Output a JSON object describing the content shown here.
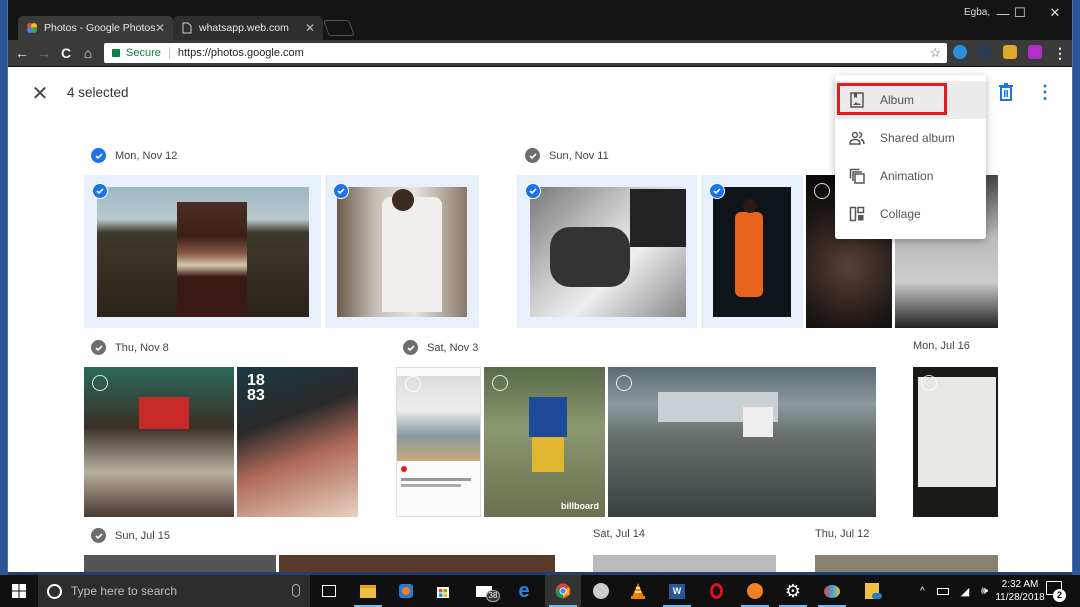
{
  "browser": {
    "tabs": [
      {
        "title": "Photos - Google Photos",
        "icon": "google-photos-icon",
        "active": true
      },
      {
        "title": "whatsapp.web.com",
        "icon": "page-icon",
        "active": false
      }
    ],
    "profile_name": "Egba,",
    "window_controls": {
      "minimize": "—",
      "maximize": "☐",
      "close": "✕"
    },
    "security_label": "Secure",
    "url": "https://photos.google.com",
    "nav_icons": {
      "back": "←",
      "forward": "→",
      "reload": "C",
      "home": "⌂"
    },
    "star": "☆",
    "menu_dots": "⋮"
  },
  "appbar": {
    "close_icon": "✕",
    "selected_count": "4 selected",
    "more_icon": "⋮"
  },
  "create_menu": {
    "items": [
      {
        "label": "Album",
        "icon": "album-icon",
        "highlighted": true
      },
      {
        "label": "Shared album",
        "icon": "shared-album-icon",
        "highlighted": false
      },
      {
        "label": "Animation",
        "icon": "animation-icon",
        "highlighted": false
      },
      {
        "label": "Collage",
        "icon": "collage-icon",
        "highlighted": false
      }
    ]
  },
  "groups": [
    {
      "date": "Mon, Nov 12",
      "checked": true,
      "photos": [
        {
          "desc": "man in striped sweater on hillside",
          "selected": true
        },
        {
          "desc": "man in white outfit seated",
          "selected": true
        }
      ]
    },
    {
      "date": "Sun, Nov 11",
      "checked": true,
      "photos": [
        {
          "desc": "man seated against brick wall, black and white",
          "selected": true
        },
        {
          "desc": "performer in orange jumpsuit on stage",
          "selected": true
        },
        {
          "desc": "performer in smoky stage light",
          "selected": false
        },
        {
          "desc": "man in grey sweater, black and white",
          "selected": false
        }
      ]
    },
    {
      "date": "Thu, Nov 8",
      "checked": false,
      "photos": [
        {
          "desc": "man crouching with bags",
          "selected": false
        },
        {
          "desc": "1883 magazine cover",
          "selected": false
        }
      ]
    },
    {
      "date": "Sat, Nov 3",
      "checked": false,
      "photos": [
        {
          "desc": "instagram screenshot of two men",
          "selected": false
        },
        {
          "desc": "man in blue hockey jersey, billboard",
          "selected": false
        },
        {
          "desc": "man sitting on unfinished wall",
          "selected": false
        }
      ]
    },
    {
      "date": "Mon, Jul 16",
      "checked": false,
      "photos": [
        {
          "desc": "handwritten letter",
          "selected": false
        }
      ]
    },
    {
      "date": "Sun, Jul 15",
      "checked": false,
      "photos": []
    },
    {
      "date": "Sat, Jul 14",
      "checked": false,
      "photos": []
    },
    {
      "date": "Thu, Jul 12",
      "checked": false,
      "photos": []
    }
  ],
  "taskbar": {
    "search_placeholder": "Type here to search",
    "mail_badge": "38",
    "time": "2:32 AM",
    "date": "11/28/2018",
    "notification_count": "2"
  }
}
